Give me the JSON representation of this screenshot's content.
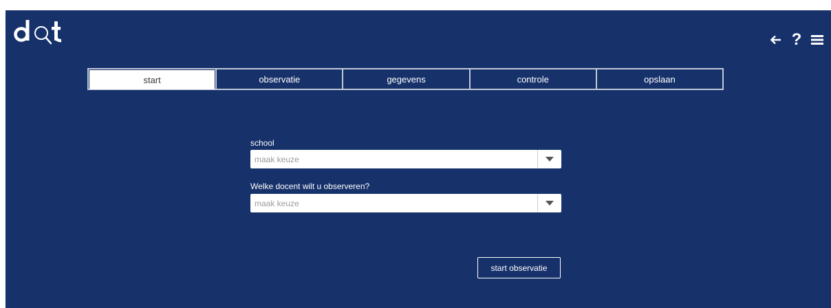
{
  "logo": {
    "text": "dot"
  },
  "header": {
    "back_icon": "arrow-left-icon",
    "help_label": "?",
    "menu_icon": "hamburger-menu-icon"
  },
  "tabs": [
    {
      "label": "start",
      "active": true
    },
    {
      "label": "observatie",
      "active": false
    },
    {
      "label": "gegevens",
      "active": false
    },
    {
      "label": "controle",
      "active": false
    },
    {
      "label": "opslaan",
      "active": false
    }
  ],
  "form": {
    "school": {
      "label": "school",
      "placeholder": "maak keuze"
    },
    "docent": {
      "label": "Welke docent wilt u observeren?",
      "placeholder": "maak keuze"
    },
    "submit_label": "start observatie"
  },
  "colors": {
    "background": "#17326b",
    "tab_border": "#c2c9d8",
    "active_tab_bg": "#ffffff",
    "text": "#ffffff"
  }
}
